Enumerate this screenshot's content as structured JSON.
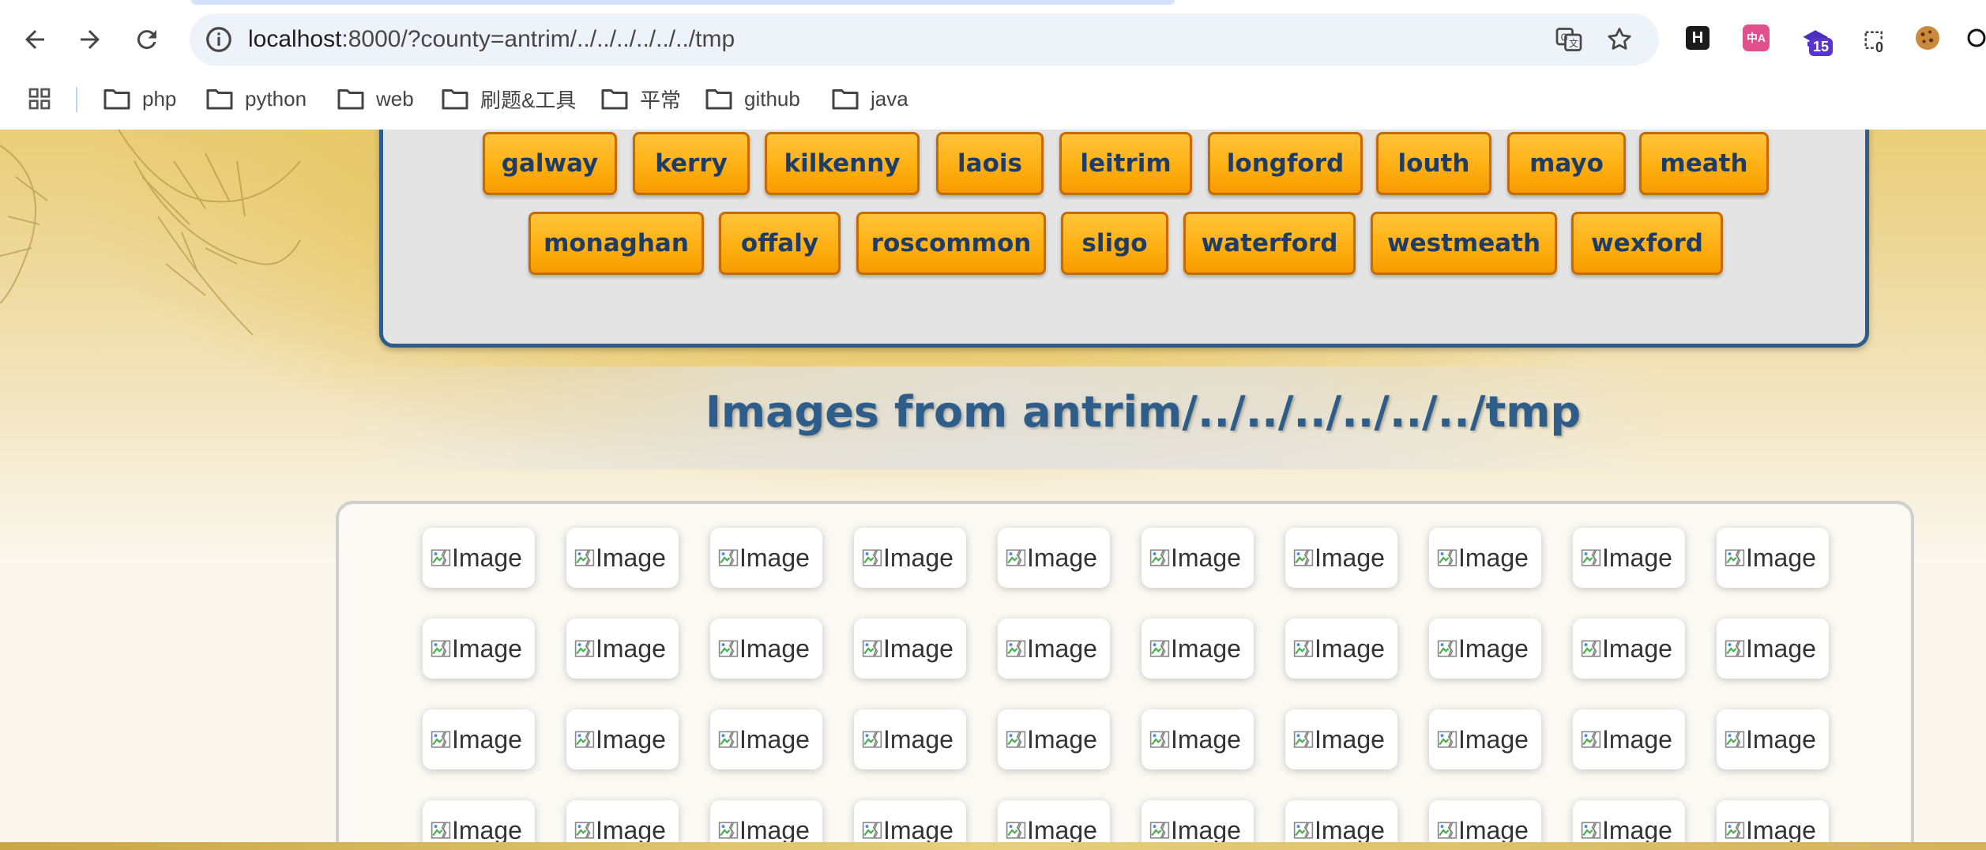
{
  "browser": {
    "url_host": "localhost",
    "url_rest": ":8000/?county=antrim/../../../../../../tmp",
    "bookmarks": [
      {
        "label": "php"
      },
      {
        "label": "python"
      },
      {
        "label": "web"
      },
      {
        "label": "刷题&工具"
      },
      {
        "label": "平常"
      },
      {
        "label": "github"
      },
      {
        "label": "java"
      }
    ],
    "extensions": [
      {
        "icon": "h-extension-icon",
        "label": "H"
      },
      {
        "icon": "translate-extension-icon",
        "label": "中A"
      },
      {
        "icon": "graduation-extension-icon",
        "badge": "15"
      },
      {
        "icon": "counter-extension-icon",
        "badge": "0"
      },
      {
        "icon": "cookie-extension-icon"
      }
    ]
  },
  "counties": {
    "row1": [
      "galway",
      "kerry",
      "kilkenny",
      "laois",
      "leitrim",
      "longford",
      "louth",
      "mayo",
      "meath"
    ],
    "row2": [
      "monaghan",
      "offaly",
      "roscommon",
      "sligo",
      "waterford",
      "westmeath",
      "wexford"
    ]
  },
  "gallery": {
    "heading": "Images from antrim/../../../../../../tmp",
    "alt_text": "Image",
    "rows_visible": 4,
    "columns": 10
  },
  "colors": {
    "county_button": "#ffb012",
    "county_text": "#1f3c64",
    "heading": "#2f5d8a",
    "panel_border": "#2f5d8a"
  }
}
